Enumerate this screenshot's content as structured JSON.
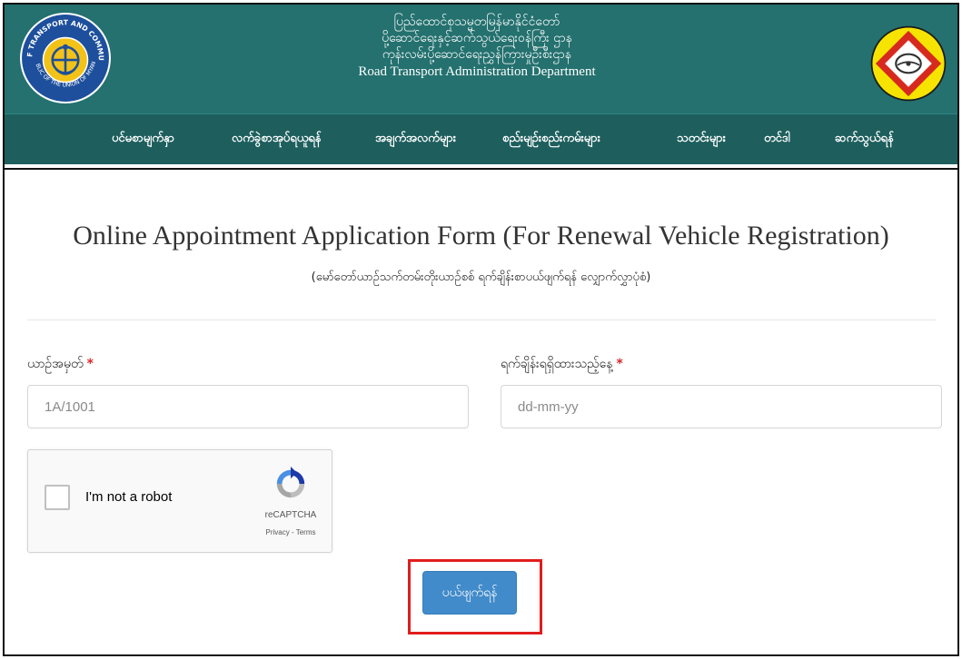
{
  "header": {
    "title_lines": [
      "ပြည်ထောင်စုသမ္မတမြန်မာနိုင်ငံတော်",
      "ပို့ဆောင်ရေးနှင့်ဆက်သွယ်ရေးဝန်ကြီး ဌာန",
      "ကုန်းလမ်းပို့ဆောင်ရေးညွှန်ကြားမှုဦးစီးဌာန"
    ],
    "title_en": "Road Transport Administration Department",
    "left_logo_text_top": "MINISTRY OF TRANSPORT AND COMMUNICATIONS",
    "left_logo_text_bottom": "REPUBLIC OF THE UNION OF MYANMAR"
  },
  "nav": {
    "items": [
      "ပင်မစာမျက်နှာ",
      "လက်ခွဲစာအုပ်ရယူရန်",
      "အချက်အလက်များ",
      "စည်းမျဉ်းစည်းကမ်းများ",
      "သတင်းများ",
      "တင်ဒါ",
      "ဆက်သွယ်ရန်"
    ]
  },
  "form": {
    "title": "Online Appointment Application Form (For Renewal Vehicle Registration)",
    "subtitle": "(မော်တော်ယာဉ်သက်တမ်းတိုးယာဉ်စစ် ရက်ချိန်းစာပယ်ဖျက်ရန် လျှောက်လွှာပုံစံ)",
    "plate_label": "ယာဉ်အမှတ်",
    "plate_placeholder": "1A/1001",
    "date_label": "ရက်ချိန်းရရှိထားသည့်နေ့",
    "date_placeholder": "dd-mm-yy",
    "required_mark": "*",
    "submit_label": "ပယ်ဖျက်ရန်"
  },
  "captcha": {
    "label": "I'm not a robot",
    "brand": "reCAPTCHA",
    "links": "Privacy - Terms"
  },
  "colors": {
    "header_bg": "#24716f",
    "nav_bg": "#1e5f5e",
    "button": "#428bca",
    "highlight": "#e11d1d",
    "required": "#d9262a"
  },
  "icons": {
    "left_logo": "ministry-seal-icon",
    "right_logo": "steering-wheel-emblem-icon",
    "captcha_logo": "recaptcha-icon"
  }
}
